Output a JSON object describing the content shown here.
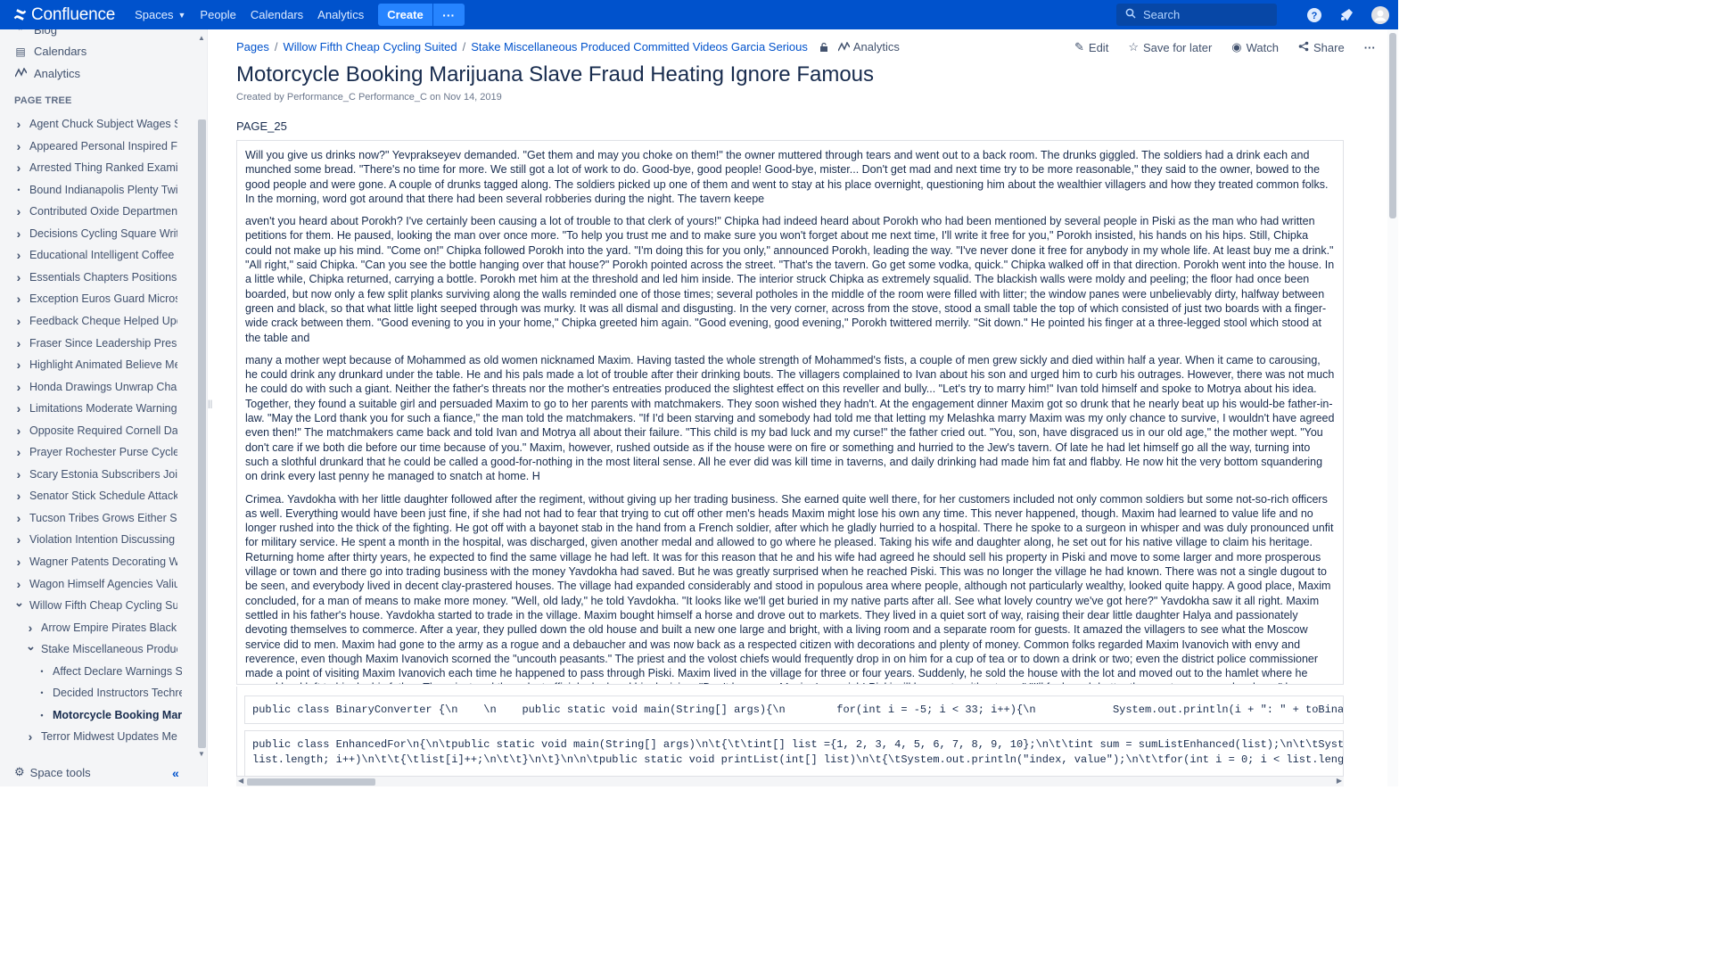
{
  "nav": {
    "logo": "Confluence",
    "items": [
      "Spaces",
      "People",
      "Calendars",
      "Analytics"
    ],
    "create": "Create",
    "more": "···",
    "search_placeholder": "Search"
  },
  "sidebar": {
    "top_links": [
      {
        "label": "Blog",
        "icon": "quote-icon"
      },
      {
        "label": "Calendars",
        "icon": "calendar-icon"
      },
      {
        "label": "Analytics",
        "icon": "analytics-icon"
      }
    ],
    "page_tree_title": "PAGE TREE",
    "tree": [
      {
        "label": "Agent Chuck Subject Wages Subs",
        "level": 0,
        "toggle": ">"
      },
      {
        "label": "Appeared Personal Inspired Fitne",
        "level": 0,
        "toggle": ">"
      },
      {
        "label": "Arrested Thing Ranked Examined",
        "level": 0,
        "toggle": ">"
      },
      {
        "label": "Bound Indianapolis Plenty Twins F",
        "level": 0,
        "toggle": "•"
      },
      {
        "label": "Contributed Oxide Department Wo",
        "level": 0,
        "toggle": ">"
      },
      {
        "label": "Decisions Cycling Square Write A",
        "level": 0,
        "toggle": ">"
      },
      {
        "label": "Educational Intelligent Coffee Par",
        "level": 0,
        "toggle": ">"
      },
      {
        "label": "Essentials Chapters Positions Me",
        "level": 0,
        "toggle": ">"
      },
      {
        "label": "Exception Euros Guard Microsoft",
        "level": 0,
        "toggle": ">"
      },
      {
        "label": "Feedback Cheque Helped Update",
        "level": 0,
        "toggle": ">"
      },
      {
        "label": "Fraser Since Leadership Presider",
        "level": 0,
        "toggle": ">"
      },
      {
        "label": "Highlight Animated Believe Meani",
        "level": 0,
        "toggle": ">"
      },
      {
        "label": "Honda Drawings Unwrap Charter",
        "level": 0,
        "toggle": ">"
      },
      {
        "label": "Limitations Moderate Warnings Th",
        "level": 0,
        "toggle": ">"
      },
      {
        "label": "Opposite Required Cornell Dated",
        "level": 0,
        "toggle": ">"
      },
      {
        "label": "Prayer Rochester Purse Cycles C",
        "level": 0,
        "toggle": ">"
      },
      {
        "label": "Scary Estonia Subscribers Joined",
        "level": 0,
        "toggle": ">"
      },
      {
        "label": "Senator Stick Schedule Attacks C",
        "level": 0,
        "toggle": ">"
      },
      {
        "label": "Tucson Tribes Grows Either Supp",
        "level": 0,
        "toggle": ">"
      },
      {
        "label": "Violation Intention Discussing Adv",
        "level": 0,
        "toggle": ">"
      },
      {
        "label": "Wagner Patents Decorating Welln",
        "level": 0,
        "toggle": ">"
      },
      {
        "label": "Wagon Himself Agencies Valium F",
        "level": 0,
        "toggle": ">"
      },
      {
        "label": "Willow Fifth Cheap Cycling Suited",
        "level": 0,
        "toggle": "v"
      },
      {
        "label": "Arrow Empire Pirates Black Pay",
        "level": 1,
        "toggle": ">"
      },
      {
        "label": "Stake Miscellaneous Produced",
        "level": 1,
        "toggle": "v"
      },
      {
        "label": "Affect Declare Warnings Seed",
        "level": 2,
        "toggle": "•"
      },
      {
        "label": "Decided Instructors Techrepu",
        "level": 2,
        "toggle": "•"
      },
      {
        "label": "Motorcycle Booking Mariju",
        "level": 2,
        "toggle": "•",
        "current": true
      },
      {
        "label": "Terror Midwest Updates Mercy S",
        "level": 1,
        "toggle": ">"
      }
    ],
    "space_tools": "Space tools",
    "collapse": "«"
  },
  "breadcrumb": {
    "items": [
      "Pages",
      "Willow Fifth Cheap Cycling Suited",
      "Stake Miscellaneous Produced Committed Videos Garcia Serious"
    ],
    "analytics": "Analytics"
  },
  "actions": {
    "edit": "Edit",
    "save": "Save for later",
    "watch": "Watch",
    "share": "Share",
    "more": "···"
  },
  "page": {
    "title": "Motorcycle Booking Marijuana Slave Fraud Heating Ignore Famous",
    "byline": "Created by Performance_C Performance_C on Nov 14, 2019",
    "label": "PAGE_25",
    "paragraphs": [
      "Will you give us drinks now?\" Yevprakseyev demanded. \"Get them and may you choke on them!\" the owner muttered through tears and went out to a back room. The drunks giggled. The soldiers had a drink each and munched some bread. \"There's no time for more. We still got a lot of work to do. Good-bye, good people! Good-bye, mister... Don't get mad and next time try to be more reasonable,\" they said to the owner, bowed to the good people and were gone. A couple of drunks tagged along. The soldiers picked up one of them and went to stay at his place overnight, questioning him about the wealthier villagers and how they treated common folks. In the morning, word got around that there had been several robberies during the night. The tavern keepe",
      "aven't you heard about Porokh? I've certainly been causing a lot of trouble to that clerk of yours!\" Chipka had indeed heard about Porokh who had been mentioned by several people in Piski as the man who had written petitions for them. He paused, looking the man over once more. \"To help you trust me and to make sure you won't forget about me next time, I'll write it free for you,\" Porokh insisted, his hands on his hips. Still, Chipka could not make up his mind. \"Come on!\" Chipka followed Porokh into the yard. \"I'm doing this for you only,\" announced Porokh, leading the way. \"I've never done it free for anybody in my whole life. At least buy me a drink.\" \"All right,\" said Chipka. \"Can you see the bottle hanging over that house?\" Porokh pointed across the street. \"That's the tavern. Go get some vodka, quick.\" Chipka walked off in that direction. Porokh went into the house. In a little while, Chipka returned, carrying a bottle. Porokh met him at the threshold and led him inside. The interior struck Chipka as extremely squalid. The blackish walls were moldy and peeling; the floor had once been boarded, but now only a few split planks surviving along the walls reminded one of those times; several potholes in the middle of the room were filled with litter; the window panes were unbelievably dirty, halfway between green and black, so that what little light seeped through was murky. It was all dismal and disgusting. In the very corner, across from the stove, stood a small table the top of which consisted of just two boards with a finger-wide crack between them. \"Good evening to you in your home,\" Chipka greeted him again. \"Good evening, good evening,\" Porokh twittered merrily. \"Sit down.\" He pointed his finger at a three-legged stool which stood at the table and",
      "many a mother wept because of Mohammed as old women nicknamed Maxim. Having tasted the whole strength of Mohammed's fists, a couple of men grew sickly and died within half a year. When it came to carousing, he could drink any drunkard under the table. He and his pals made a lot of trouble after their drinking bouts. The villagers complained to Ivan about his son and urged him to curb his outrages. However, there was not much he could do with such a giant. Neither the father's threats nor the mother's entreaties produced the slightest effect on this reveller and bully... \"Let's try to marry him!\" Ivan told himself and spoke to Motrya about his idea. Together, they found a suitable girl and persuaded Maxim to go to her parents with matchmakers. They soon wished they hadn't. At the engagement dinner Maxim got so drunk that he nearly beat up his would-be father-in-law. \"May the Lord thank you for such a fiance,\" the man told the matchmakers. \"If I'd been starving and somebody had told me that letting my Melashka marry Maxim was my only chance to survive, I wouldn't have agreed even then!\" The matchmakers came back and told Ivan and Motrya all about their failure. \"This child is my bad luck and my curse!\" the father cried out. \"You, son, have disgraced us in our old age,\" the mother wept. \"You don't care if we both die before our time because of you.\" Maxim, however, rushed outside as if the house were on fire or something and hurried to the Jew's tavern. Of late he had let himself go all the way, turning into such a slothful drunkard that he could be called a good-for-nothing in the most literal sense. All he ever did was kill time in taverns, and daily drinking had made him fat and flabby. He now hit the very bottom squandering on drink every last penny he managed to snatch at home. H",
      "Crimea. Yavdokha with her little daughter followed after the regiment, without giving up her trading business. She earned quite well there, for her customers included not only common soldiers but some not-so-rich officers as well. Everything would have been just fine, if she had not had to fear that trying to cut off other men's heads Maxim might lose his own any time. This never happened, though. Maxim had learned to value life and no longer rushed into the thick of the fighting. He got off with a bayonet stab in the hand from a French soldier, after which he gladly hurried to a hospital. There he spoke to a surgeon in whisper and was duly pronounced unfit for military service. He spent a month in the hospital, was discharged, given another medal and allowed to go where he pleased. Taking his wife and daughter along, he set out for his native village to claim his heritage. Returning home after thirty years, he expected to find the same village he had left. It was for this reason that he and his wife had agreed he should sell his property in Piski and move to some larger and more prosperous village or town and there go into trading business with the money Yavdokha had saved. But he was greatly surprised when he reached Piski. This was no longer the village he had known. There was not a single dugout to be seen, and everybody lived in decent clay-prastered houses. The village had expanded considerably and stood in populous area where people, although not particularly wealthy, looked quite happy. A good place, Maxim concluded, for a man of means to make more money. \"Well, old lady,\" he told Yavdokha. \"It looks like we'll get buried in my native parts after all. See what lovely country we've got here?\" Yavdokha saw it all right. Maxim settled in his father's house. Yavdokha started to trade in the village. Maxim bought himself a horse and drove out to markets. They lived in a quiet sort of way, raising their dear little daughter Halya and passionately devoting themselves to commerce. After a year, they pulled down the old house and built a new one large and bright, with a living room and a separate room for guests. It amazed the villagers to see what the Moscow service did to men. Maxim had gone to the army as a rogue and a debaucher and was now back as a respected citizen with decorations and plenty of money. Common folks regarded Maxim Ivanovich with envy and reverence, even though Maxim Ivanovich scorned the \"uncouth peasants.\" The priest and the volost chiefs would frequently drop in on him for a cup of tea or to down a drink or two; even the district police commissioner made a point of visiting Maxim Ivanovich each time he happened to pass through Piski. Maxim lived in the village for three or four years. Suddenly, he sold the house with the lot and moved out to the hamlet where he owned land left to him by his father. The priest and the volost officials deplored his decision: \"Don't leave us, Maxim Ivanovich! Piski will be empty without you.\" \"I'll feel much better there not as cramped as here,\" he explained. \"Lots of envious types in the village. Nobody passes my place here without casting envious glances my way.\" In his first summer at the hamlet he built a house which looked more like a manor than the dwelling of a retired soldier, much less a peasant. The following year he bought three horses, built stables and log barns and surrounded the entire lot with an imme"
    ],
    "code": [
      "public class BinaryConverter {\\n    \\n    public static void main(String[] args){\\n        for(int i = -5; i < 33; i++){\\n            System.out.println(i + \": \" + toBinary(i));\\n",
      "public class EnhancedFor\\n{\\n\\tpublic static void main(String[] args)\\n\\t{\\t\\tint[] list ={1, 2, 3, 4, 5, 6, 7, 8, 9, 10};\\n\\t\\tint sum = sumListEnhanced(list);\\n\\t\\tSystem.out.prin",
      "list.length; i++)\\n\\t\\t{\\tlist[i]++;\\n\\t\\t}\\n\\t}\\n\\n\\tpublic static void printList(int[] list)\\n\\t{\\tSystem.out.println(\"index, value\");\\n\\t\\tfor(int i = 0; i < list.length; i++)\\"
    ]
  }
}
